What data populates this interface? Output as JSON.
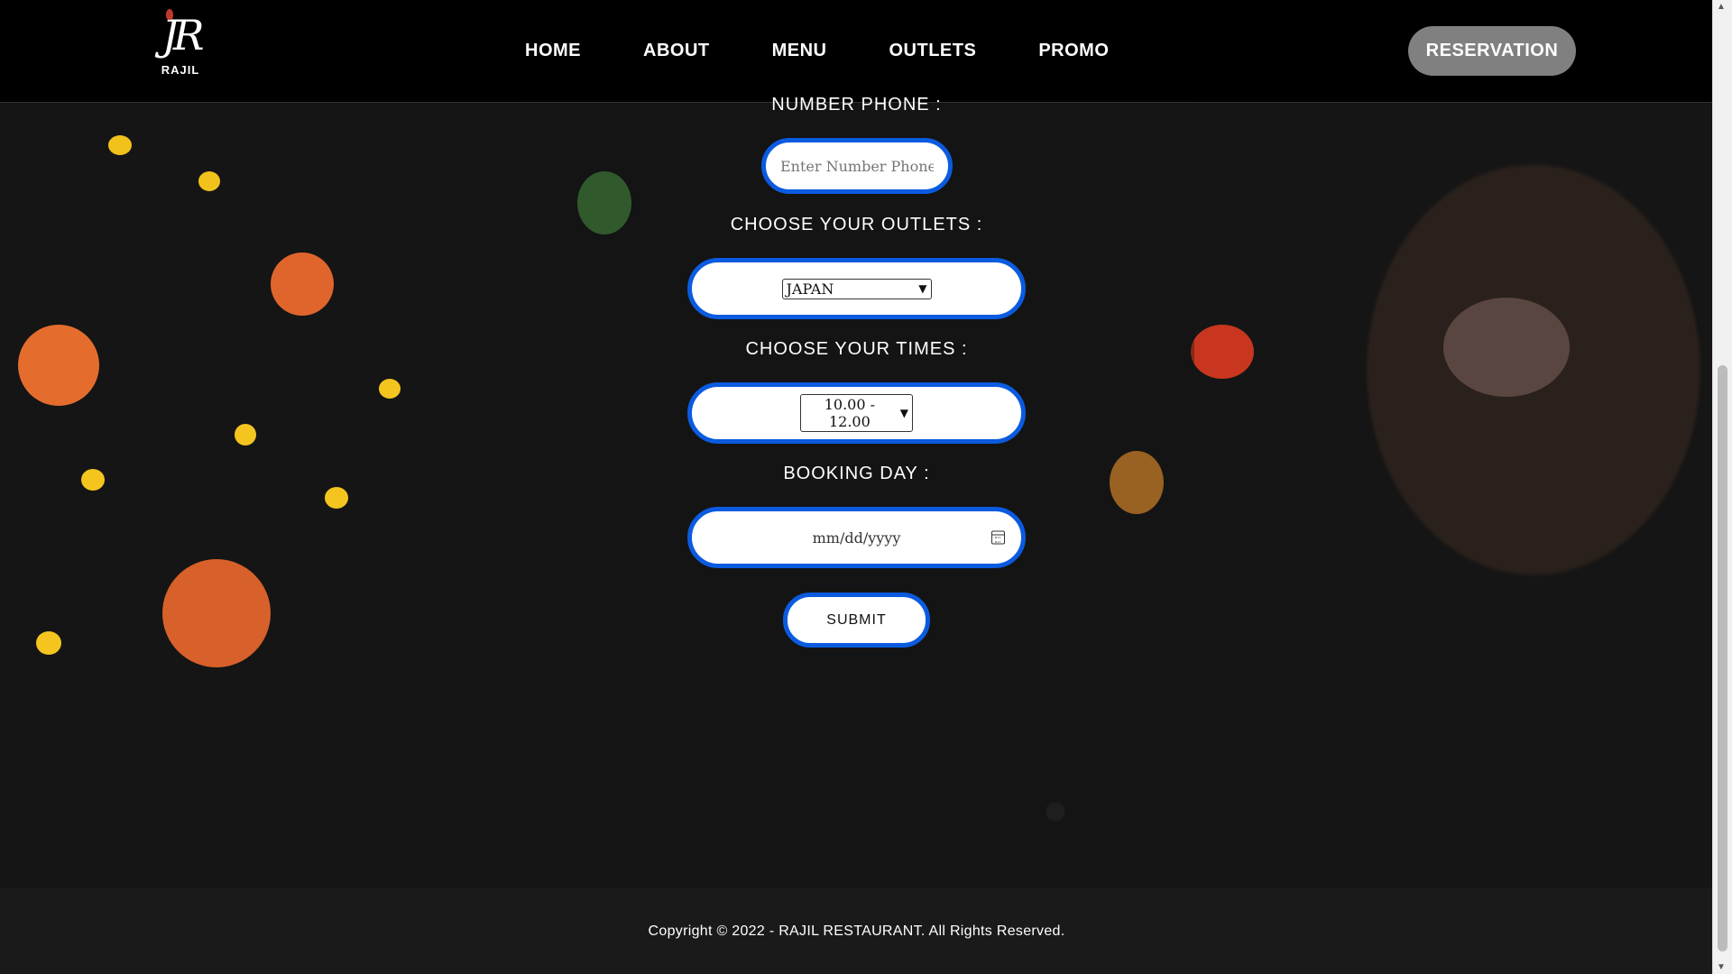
{
  "brand": {
    "name": "RAJIL",
    "logo_mark": "JR"
  },
  "nav": {
    "items": [
      {
        "label": "HOME"
      },
      {
        "label": "ABOUT"
      },
      {
        "label": "MENU"
      },
      {
        "label": "OUTLETS"
      },
      {
        "label": "PROMO"
      }
    ],
    "cta_label": "RESERVATION"
  },
  "form": {
    "phone_label": "NUMBER PHONE :",
    "phone_placeholder": "Enter Number Phone",
    "outlets_label": "CHOOSE YOUR OUTLETS :",
    "outlets_selected": "JAPAN",
    "times_label": "CHOOSE YOUR TIMES :",
    "times_selected": "10.00 - 12.00",
    "day_label": "BOOKING DAY :",
    "day_placeholder": "mm/dd/yyyy",
    "submit_label": "SUBMIT"
  },
  "footer": {
    "copyright": "Copyright © 2022 - RAJIL RESTAURANT. All Rights Reserved."
  },
  "colors": {
    "accent_border": "#0b5be0",
    "header_bg": "#000000",
    "cta_bg": "#808080",
    "footer_bg": "#1a1a1a"
  },
  "icons": [
    "calendar-icon",
    "chevron-down-icon",
    "scroll-up-icon",
    "scroll-down-icon"
  ]
}
